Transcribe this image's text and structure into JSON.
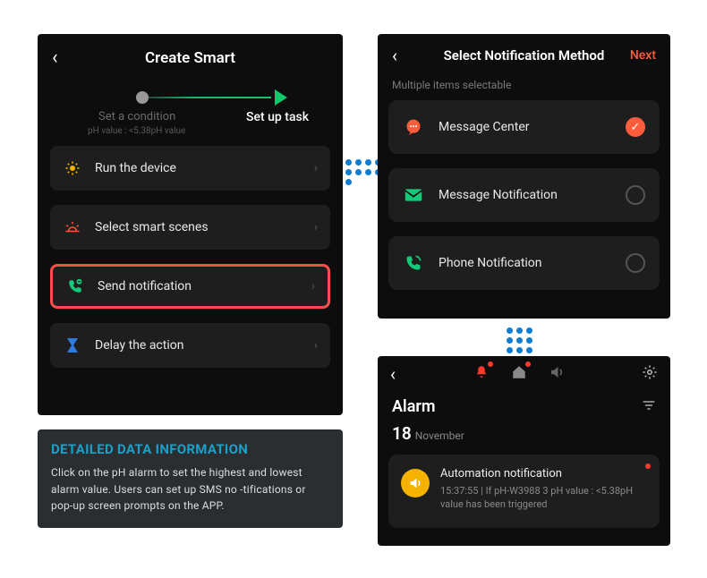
{
  "left": {
    "title": "Create Smart",
    "step1": "Set a condition",
    "step_sub": "pH value : <5.38pH value",
    "step2": "Set up task",
    "items": [
      {
        "label": "Run the device"
      },
      {
        "label": "Select smart scenes"
      },
      {
        "label": "Send notification"
      },
      {
        "label": "Delay the action"
      }
    ]
  },
  "rt": {
    "title": "Select Notification Method",
    "next": "Next",
    "subtitle": "Multiple items selectable",
    "items": [
      {
        "label": "Message Center"
      },
      {
        "label": "Message Notification"
      },
      {
        "label": "Phone Notification"
      }
    ]
  },
  "rb": {
    "title": "Alarm",
    "date_day": "18",
    "date_month": "November",
    "card_title": "Automation notification",
    "card_body": "15:37:55 | If pH-W3988 3 pH value : <5.38pH value has been triggered"
  },
  "info": {
    "title": "DETAILED DATA INFORMATION",
    "body": "Click on the pH alarm to set the highest and lowest alarm value. Users can set up SMS no -tifications or pop-up screen prompts on the APP."
  }
}
